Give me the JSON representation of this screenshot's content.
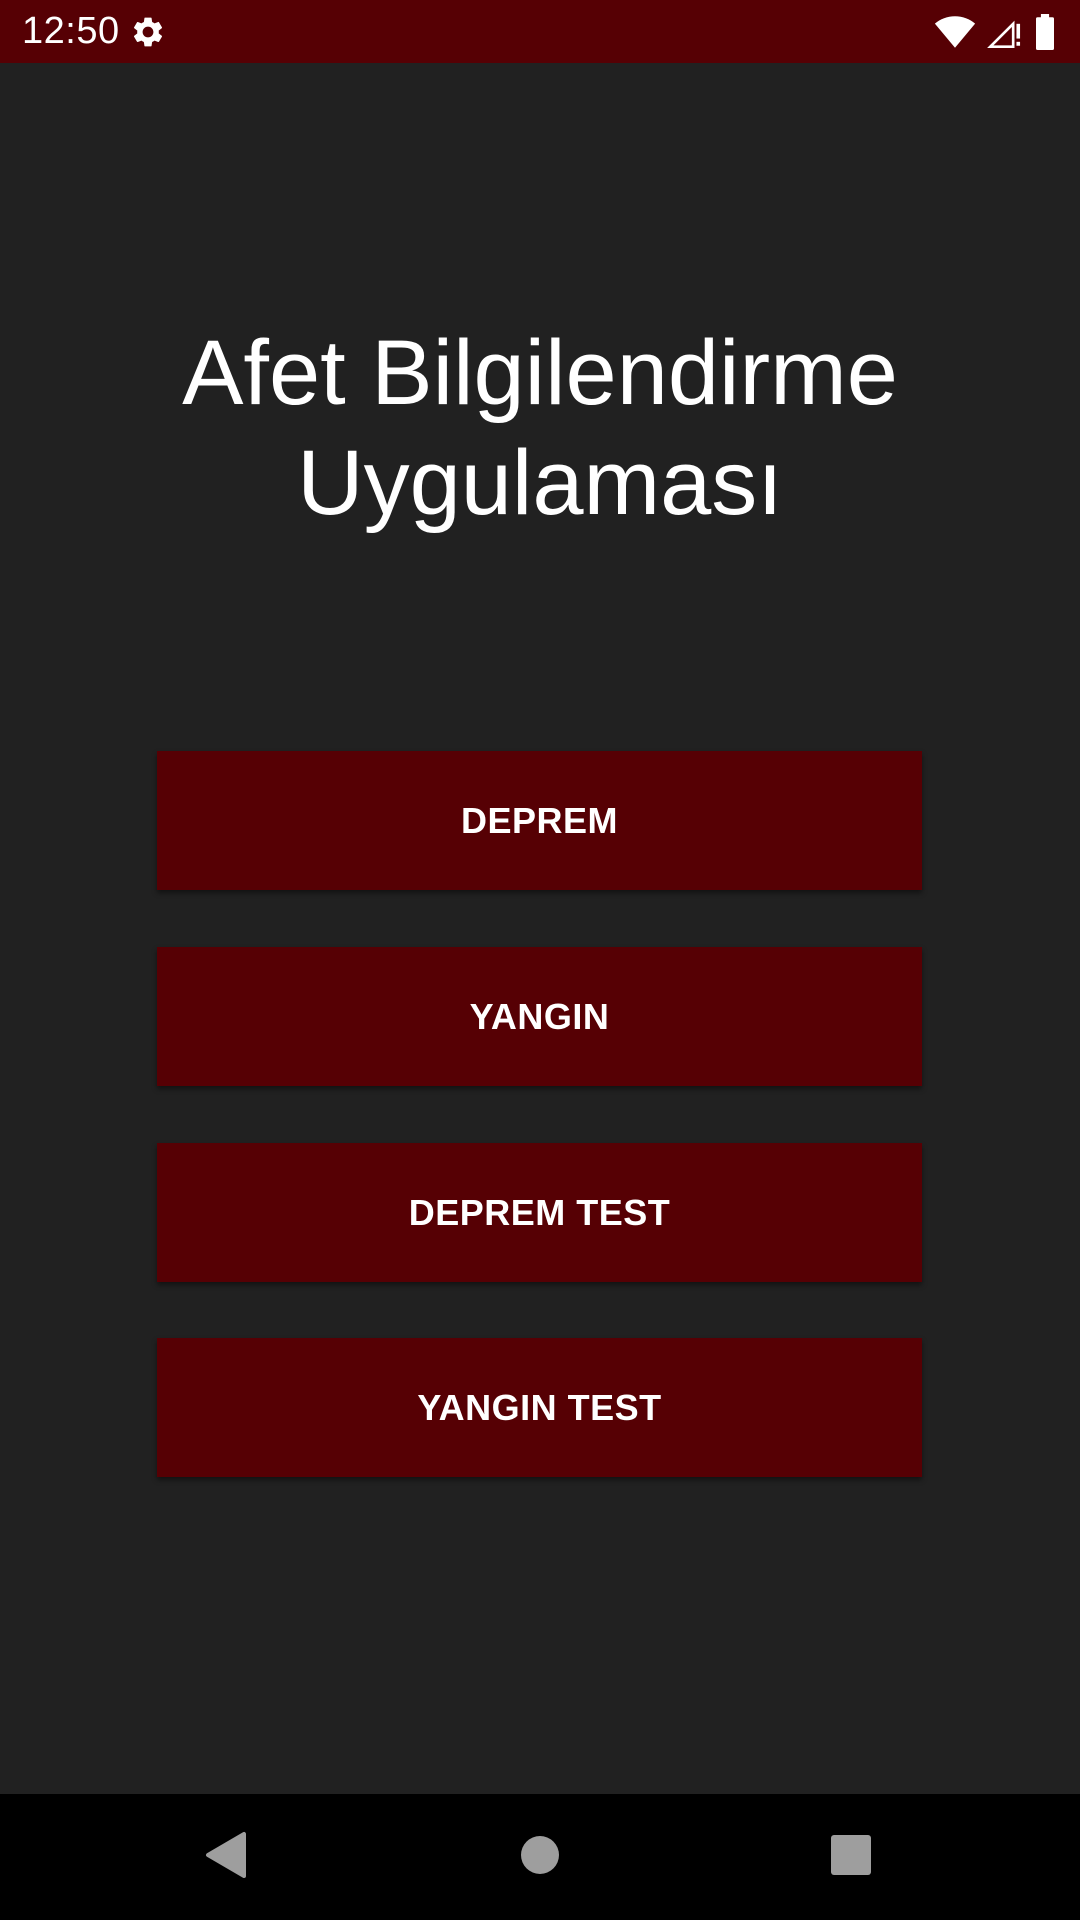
{
  "status_bar": {
    "time": "12:50",
    "background": "#560004",
    "icons": [
      "gear-icon",
      "wifi-icon",
      "signal-icon",
      "battery-icon"
    ]
  },
  "app": {
    "title_line1": "Afet Bilgilendirme",
    "title_line2": "Uygulaması",
    "background": "#212121"
  },
  "buttons": [
    {
      "label": "DEPREM"
    },
    {
      "label": "YANGIN"
    },
    {
      "label": "DEPREM TEST"
    },
    {
      "label": "YANGIN TEST"
    }
  ],
  "colors": {
    "accent": "#560004",
    "text": "#ffffff",
    "nav_icon": "#9e9e9e"
  },
  "nav_bar": {
    "icons": [
      "back-icon",
      "home-icon",
      "recent-apps-icon"
    ]
  }
}
